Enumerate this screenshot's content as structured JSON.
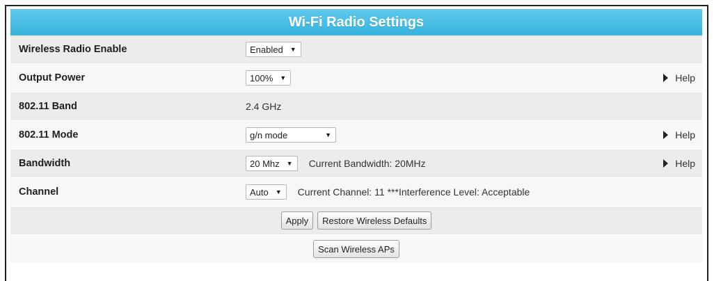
{
  "title": "Wi-Fi Radio Settings",
  "help_label": "Help",
  "rows": {
    "radio_enable": {
      "label": "Wireless Radio Enable",
      "select": "Enabled"
    },
    "output_power": {
      "label": "Output Power",
      "select": "100%"
    },
    "band": {
      "label": "802.11 Band",
      "value": "2.4 GHz"
    },
    "mode": {
      "label": "802.11 Mode",
      "select": "g/n mode"
    },
    "bandwidth": {
      "label": "Bandwidth",
      "select": "20 Mhz",
      "info": "Current Bandwidth: 20MHz"
    },
    "channel": {
      "label": "Channel",
      "select": "Auto",
      "info": "Current Channel: 11 ***Interference Level: Acceptable"
    }
  },
  "buttons": {
    "apply": "Apply",
    "restore": "Restore Wireless Defaults",
    "scan": "Scan Wireless APs"
  },
  "colors": {
    "header": "#36b3df",
    "row_shade": "#ececec",
    "row_light": "#f7f7f7"
  }
}
